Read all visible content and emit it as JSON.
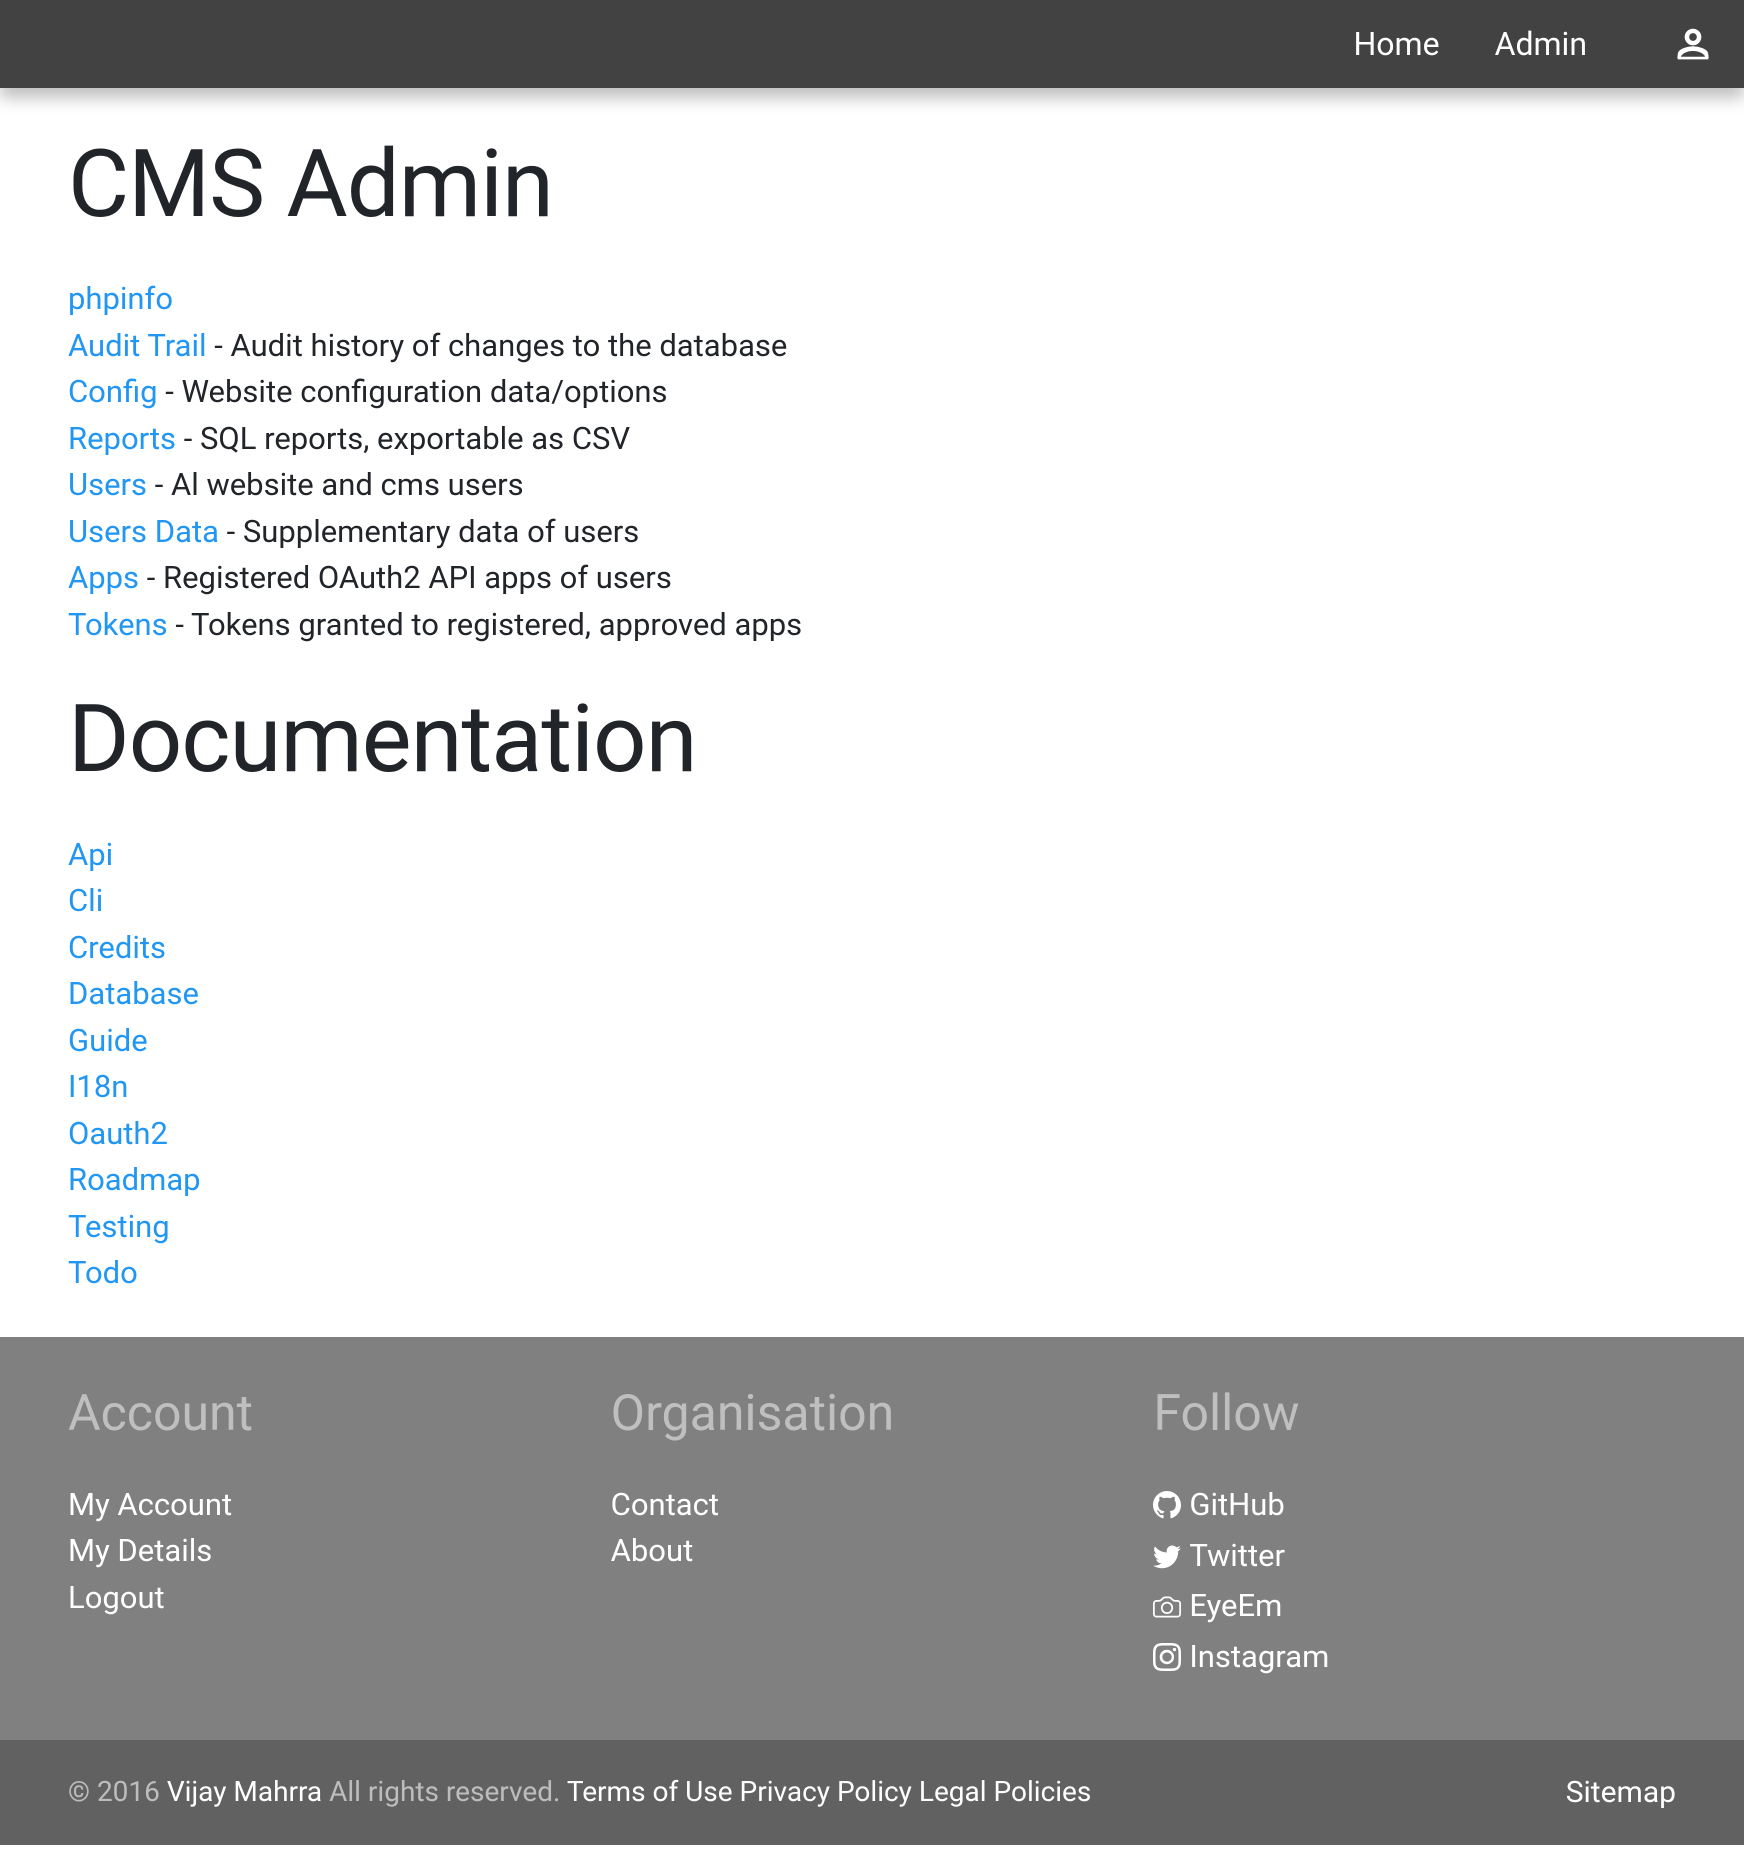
{
  "nav": {
    "home": "Home",
    "admin": "Admin"
  },
  "main": {
    "heading1": "CMS Admin",
    "adminLinks": [
      {
        "label": "phpinfo",
        "desc": ""
      },
      {
        "label": "Audit Trail",
        "desc": " - Audit history of changes to the database"
      },
      {
        "label": "Config",
        "desc": " - Website configuration data/options"
      },
      {
        "label": "Reports",
        "desc": " - SQL reports, exportable as CSV"
      },
      {
        "label": "Users",
        "desc": " - Al website and cms users"
      },
      {
        "label": "Users Data",
        "desc": " - Supplementary data of users"
      },
      {
        "label": "Apps",
        "desc": " - Registered OAuth2 API apps of users"
      },
      {
        "label": "Tokens",
        "desc": " - Tokens granted to registered, approved apps"
      }
    ],
    "heading2": "Documentation",
    "docLinks": [
      {
        "label": "Api"
      },
      {
        "label": "Cli"
      },
      {
        "label": "Credits"
      },
      {
        "label": "Database"
      },
      {
        "label": "Guide"
      },
      {
        "label": "I18n"
      },
      {
        "label": "Oauth2"
      },
      {
        "label": "Roadmap"
      },
      {
        "label": "Testing"
      },
      {
        "label": "Todo"
      }
    ]
  },
  "footer": {
    "account": {
      "heading": "Account",
      "links": [
        {
          "label": "My Account"
        },
        {
          "label": "My Details"
        },
        {
          "label": "Logout"
        }
      ]
    },
    "organisation": {
      "heading": "Organisation",
      "links": [
        {
          "label": "Contact"
        },
        {
          "label": "About"
        }
      ]
    },
    "follow": {
      "heading": "Follow",
      "links": [
        {
          "label": "GitHub",
          "icon": "github"
        },
        {
          "label": "Twitter",
          "icon": "twitter"
        },
        {
          "label": "EyeEm",
          "icon": "camera"
        },
        {
          "label": "Instagram",
          "icon": "instagram"
        }
      ]
    },
    "copyright": {
      "prefix": "© 2016 ",
      "author": "Vijay Mahrra",
      "middle": " All rights reserved. ",
      "terms": "Terms of Use",
      "privacy": "Privacy Policy",
      "legal": "Legal Policies"
    },
    "sitemap": "Sitemap"
  }
}
